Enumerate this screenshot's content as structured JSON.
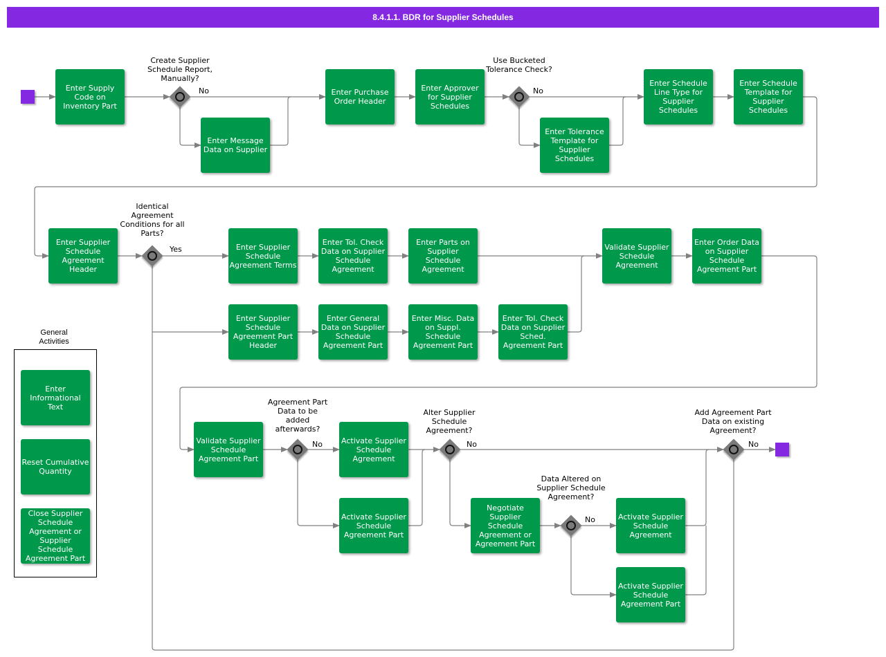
{
  "header": {
    "title": "8.4.1.1. BDR for Supplier Schedules"
  },
  "colors": {
    "task": "#00984a",
    "event": "#8428e2",
    "gateway": "#7a7a7a",
    "flow": "#808080"
  },
  "tasks": {
    "t1": "Enter Supply Code on Inventory Part",
    "t2": "Enter Message Data on Supplier",
    "t3": "Enter Purchase Order Header",
    "t4": "Enter Approver for Supplier Schedules",
    "t5": "Enter Tolerance Template for Supplier Schedules",
    "t6": "Enter Schedule Line Type for Supplier Schedules",
    "t7": "Enter Schedule Template for Supplier Schedules",
    "t8": "Enter Supplier Schedule Agreement Header",
    "t9": "Enter Supplier Schedule Agreement Terms",
    "t10": "Enter Tol. Check Data on Supplier Schedule Agreement",
    "t11": "Enter Parts on Supplier Schedule Agreement",
    "t12": "Enter Supplier Schedule Agreement Part Header",
    "t13": "Enter General Data on Supplier Schedule Agreement Part",
    "t14": "Enter Misc. Data on Suppl. Schedule Agreement Part",
    "t15": "Enter Tol. Check Data on Supplier Sched. Agreement Part",
    "t16": "Validate Supplier Schedule Agreement",
    "t17": "Enter Order Data on Supplier Schedule Agreement Part",
    "t18": "Validate Supplier Schedule Agreement Part",
    "t19": "Activate Supplier Schedule Agreement",
    "t20": "Activate Supplier Schedule Agreement Part",
    "t21": "Negotiate Supplier Schedule Agreement or Agreement Part",
    "t22": "Activate Supplier Schedule Agreement",
    "t23": "Activate Supplier Schedule Agreement Part"
  },
  "gateways": {
    "g1": {
      "question": "Create Supplier Schedule Report, Manually?",
      "label": "No"
    },
    "g2": {
      "question": "Use Bucketed Tolerance Check?",
      "label": "No"
    },
    "g3": {
      "question": "Identical Agreement Conditions for all Parts?",
      "label": "Yes"
    },
    "g4": {
      "question": "Agreement Part Data to be added afterwards?",
      "label": "No"
    },
    "g5": {
      "question": "Alter Supplier Schedule Agreement?",
      "label": "No"
    },
    "g6": {
      "question": "Data Altered on Supplier Schedule Agreement?",
      "label": "No"
    },
    "g7": {
      "question": "Add Agreement Part Data on existing Agreement?",
      "label": "No"
    }
  },
  "general_activities": {
    "title": "General Activities",
    "items": [
      "Enter Informational Text",
      "Reset Cumulative Quantity",
      "Close Supplier Schedule Agreement or Supplier Schedule Agreement Part"
    ]
  }
}
